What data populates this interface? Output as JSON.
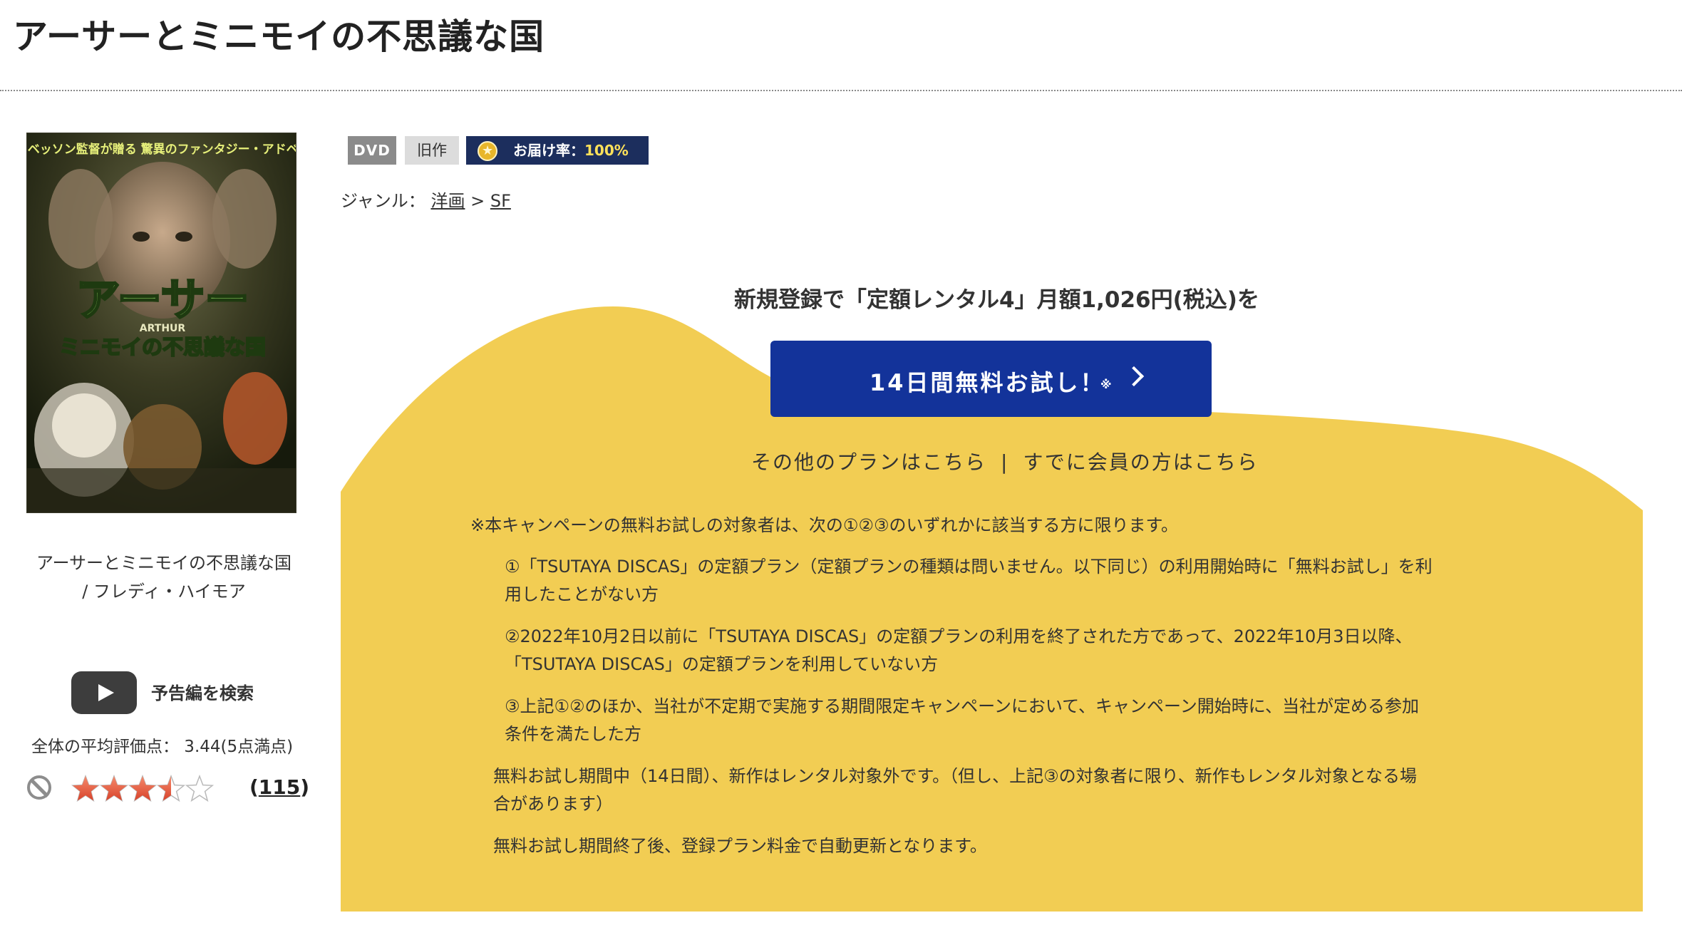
{
  "title": "アーサーとミニモイの不思議な国",
  "poster": {
    "tagline": "リュック・ベッソン監督が贈る 驚異のファンタジー・アドベンチャー!!",
    "logo_main": "アーサー",
    "logo_sub": "ミニモイの不思議な国",
    "logo_en": "ARTHUR"
  },
  "caption": {
    "line1": "アーサーとミニモイの不思議な国",
    "line2": "/ フレディ・ハイモア"
  },
  "trailer": {
    "label": "予告編を検索"
  },
  "rating": {
    "text": "全体の平均評価点： 3.44(5点満点)",
    "value": 3.44,
    "max": 5,
    "count_open": "(",
    "count": "115",
    "count_close": ")"
  },
  "badges": {
    "dvd": "DVD",
    "old": "旧作",
    "delivery_label": "お届け率：",
    "delivery_rate": "100%"
  },
  "genre": {
    "label": "ジャンル：",
    "items": [
      "洋画",
      "SF"
    ],
    "sep": ">"
  },
  "promo": {
    "lead": "新規登録で「定額レンタル4」月額1,026円(税込)を",
    "cta": "14日間無料お試し！",
    "cta_note": "※",
    "other_plans": "その他のプランはこちら",
    "separator": "|",
    "members": "すでに会員の方はこちら"
  },
  "notes": {
    "intro": "※本キャンペーンの無料お試しの対象者は、次の①②③のいずれかに該当する方に限ります。",
    "n1_l1": "①「TSUTAYA DISCAS」の定額プラン（定額プランの種類は問いません。以下同じ）の利用開始時に「無料お試し」を利",
    "n1_l2": "用したことがない方",
    "n2_l1": "②2022年10月2日以前に「TSUTAYA DISCAS」の定額プランの利用を終了された方であって、2022年10月3日以降、",
    "n2_l2": "「TSUTAYA DISCAS」の定額プランを利用していない方",
    "n3_l1": "③上記①②のほか、当社が不定期で実施する期間限定キャンペーンにおいて、キャンペーン開始時に、当社が定める参加",
    "n3_l2": "条件を満たした方",
    "p1_l1": "無料お試し期間中（14日間）、新作はレンタル対象外です。（但し、上記③の対象者に限り、新作もレンタル対象となる場",
    "p1_l2": "合があります）",
    "p2": "無料お試し期間終了後、登録プラン料金で自動更新となります。"
  },
  "colors": {
    "panel_yellow": "#f2cd53",
    "cta_blue": "#13339a",
    "badge_navy": "#1c2e5d",
    "star_red": "#e4563b"
  }
}
